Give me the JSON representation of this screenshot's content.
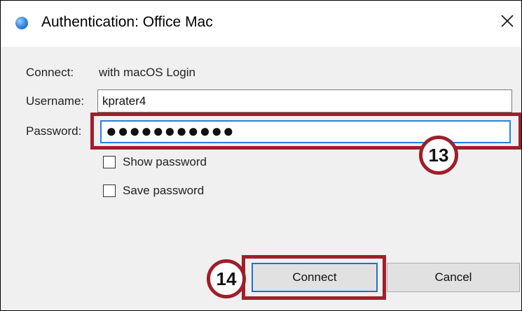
{
  "window": {
    "title": "Authentication: Office Mac",
    "close_glyph": "✕"
  },
  "form": {
    "connect_label": "Connect:",
    "connect_value": "with macOS Login",
    "username_label": "Username:",
    "username_value": "kprater4",
    "password_label": "Password:",
    "password_masked": "●●●●●●●●●●●",
    "show_password_label": "Show password",
    "show_password_checked": false,
    "save_password_label": "Save password",
    "save_password_checked": false
  },
  "buttons": {
    "connect_label": "Connect",
    "cancel_label": "Cancel"
  },
  "annotations": {
    "step_password": "13",
    "step_connect": "14",
    "highlight_color": "#a11e2b"
  },
  "colors": {
    "dialog_bg": "#f0f0f0",
    "focus_border": "#2f7fd8",
    "default_button_border": "#1a73d0"
  }
}
